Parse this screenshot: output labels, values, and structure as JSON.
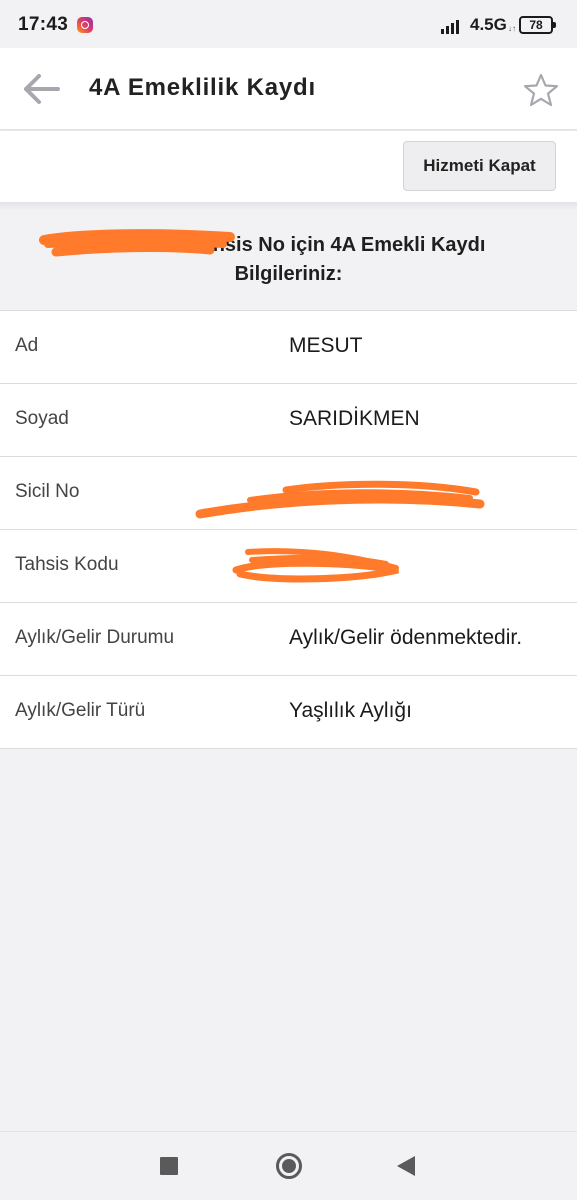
{
  "status_bar": {
    "time": "17:43",
    "network": "4.5G",
    "network_activity": "↓↑",
    "battery": "78",
    "notification_icon": "instagram-icon"
  },
  "app_bar": {
    "title": "4A Emeklilik Kaydı",
    "back_icon": "arrow-left-icon",
    "favorite_icon": "star-outline-icon"
  },
  "actions": {
    "close_service_label": "Hizmeti Kapat"
  },
  "section": {
    "heading_line1": "ahsis No için 4A Emekli Kaydı",
    "heading_line2": "Bilgileriniz:"
  },
  "rows": [
    {
      "label": "Ad",
      "value": "MESUT"
    },
    {
      "label": "Soyad",
      "value": "SARIDİKMEN"
    },
    {
      "label": "Sicil No",
      "value": ""
    },
    {
      "label": "Tahsis Kodu",
      "value": ""
    },
    {
      "label": "Aylık/Gelir Durumu",
      "value": "Aylık/Gelir ödenmektedir."
    },
    {
      "label": "Aylık/Gelir Türü",
      "value": "Yaşlılık Aylığı"
    }
  ],
  "colors": {
    "redaction": "#ff7a2a",
    "accent_gray": "#a7a7b0"
  },
  "nav_bar": {
    "recents_icon": "square-icon",
    "home_icon": "circle-icon",
    "back_icon": "triangle-back-icon"
  }
}
